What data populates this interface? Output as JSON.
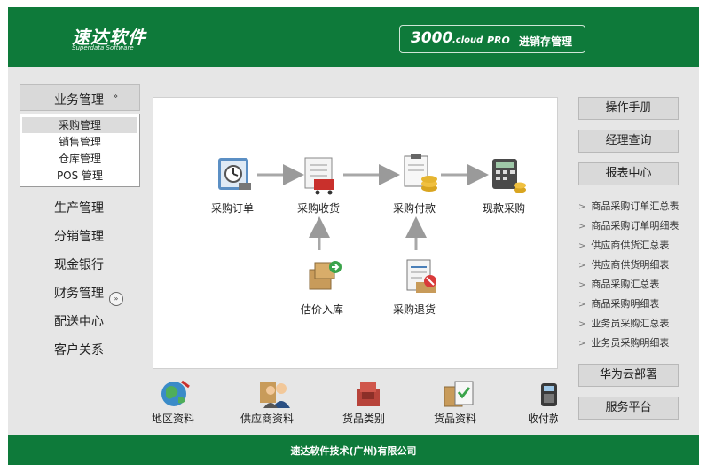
{
  "header": {
    "logo_cn": "速达软件",
    "logo_en": "Superdata Software",
    "product_num": "3000",
    "product_cloud": ".cloud",
    "product_pro": "PRO",
    "product_title": "进销存管理"
  },
  "left_menu": {
    "active_section": "业务管理",
    "sub_items": [
      "采购管理",
      "销售管理",
      "仓库管理",
      "POS 管理"
    ],
    "selected_sub": "采购管理",
    "items": [
      "生产管理",
      "分销管理",
      "现金银行",
      "财务管理",
      "配送中心",
      "客户关系"
    ]
  },
  "flow": {
    "nodes": [
      "采购订单",
      "采购收货",
      "采购付款",
      "现款采购",
      "估价入库",
      "采购退货"
    ]
  },
  "bottom_bar": {
    "items": [
      "地区资料",
      "供应商资料",
      "货品类别",
      "货品资料",
      "收付款"
    ]
  },
  "right_panel": {
    "buttons": [
      "操作手册",
      "经理查询",
      "报表中心"
    ],
    "reports": [
      "商品采购订单汇总表",
      "商品采购订单明细表",
      "供应商供货汇总表",
      "供应商供货明细表",
      "商品采购汇总表",
      "商品采购明细表",
      "业务员采购汇总表",
      "业务员采购明细表"
    ],
    "bottom_buttons": [
      "华为云部署",
      "服务平台"
    ]
  },
  "footer": {
    "company": "速达软件技术(广州)有限公司"
  },
  "colors": {
    "brand_green": "#0e7a3a",
    "panel_bg": "#e6e6e6"
  }
}
